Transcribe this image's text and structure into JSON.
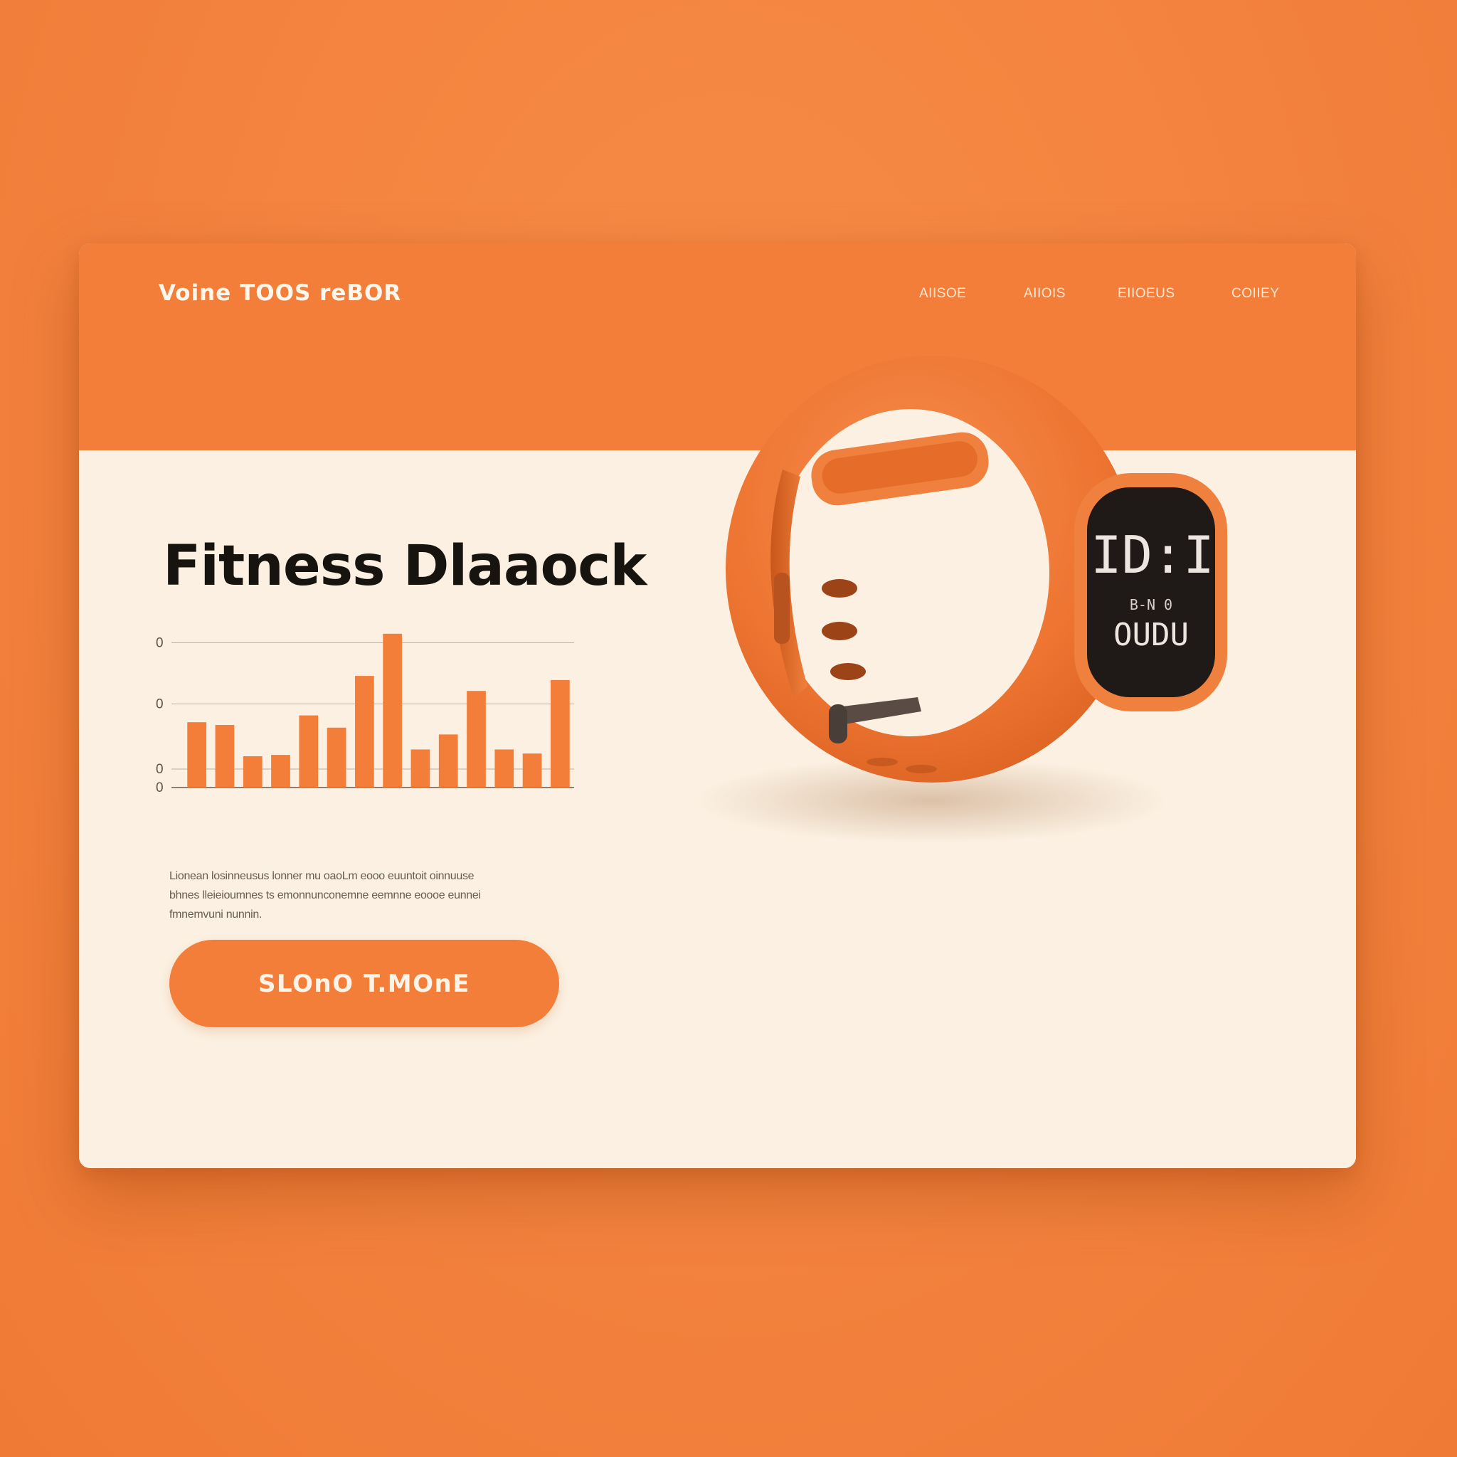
{
  "brand": "Voine TOOS reBOR",
  "nav": {
    "items": [
      {
        "label": "AIISOE"
      },
      {
        "label": "AIIOIS"
      },
      {
        "label": "EIIOEUS"
      },
      {
        "label": "COIIEY"
      }
    ]
  },
  "hero": {
    "title": "Fitness Dlaaock",
    "description_lines": [
      "Lionean losinneusus lonner mu oaoLm eooo euuntoit oinnuuse",
      "bhnes lleieioumnes ts emonnunconemne eemnne eoooe eunnei",
      "fmnemvuni nunnin."
    ],
    "cta_label": "SLOnO T.MOnE"
  },
  "device_screen": {
    "primary": "ID:I",
    "label": "B-N  0",
    "secondary": "OUDU"
  },
  "colors": {
    "background": "#F3823E",
    "header": "#F27E3A",
    "panel": "#FBF0E1",
    "accent": "#F27E3A",
    "text_dark": "#17130F",
    "strap": "#EE7532",
    "screen": "#1F1A17"
  },
  "chart_data": {
    "type": "bar",
    "ytick_labels": [
      "0",
      "0",
      "0",
      "0"
    ],
    "values": [
      48,
      46,
      23,
      24,
      53,
      44,
      82,
      113,
      28,
      39,
      71,
      28,
      25,
      79
    ],
    "ylim": [
      0,
      115
    ],
    "grid": true,
    "legend": "none"
  }
}
